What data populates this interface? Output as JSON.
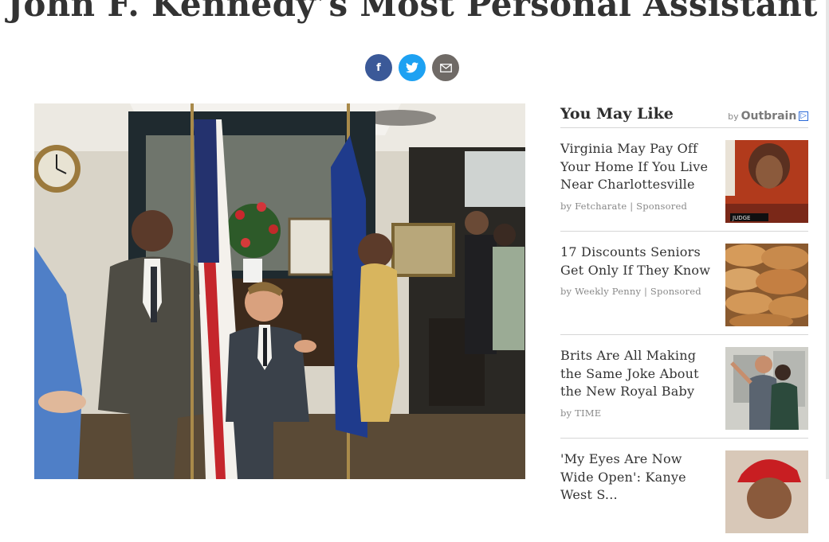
{
  "article": {
    "headline": "John F. Kennedy’s Most Personal Assistant"
  },
  "share": {
    "facebook_icon": "f",
    "twitter_icon": "twitter-bird",
    "email_icon": "envelope"
  },
  "sidebar": {
    "title": "You May Like",
    "by_label": "by",
    "brand": "Outbrain",
    "items": [
      {
        "title": "Virginia May Pay Off Your Home If You Live Near Charlottesville",
        "source": "by Fetcharate | Sponsored",
        "thumb_label": "JUDGE"
      },
      {
        "title": "17 Discounts Seniors Get Only If They Know",
        "source": "by Weekly Penny | Sponsored"
      },
      {
        "title": "Brits Are All Making the Same Joke About the New Royal Baby",
        "source": "by TIME"
      },
      {
        "title": "'My Eyes Are Now Wide Open': Kanye West S...",
        "source": ""
      }
    ]
  }
}
